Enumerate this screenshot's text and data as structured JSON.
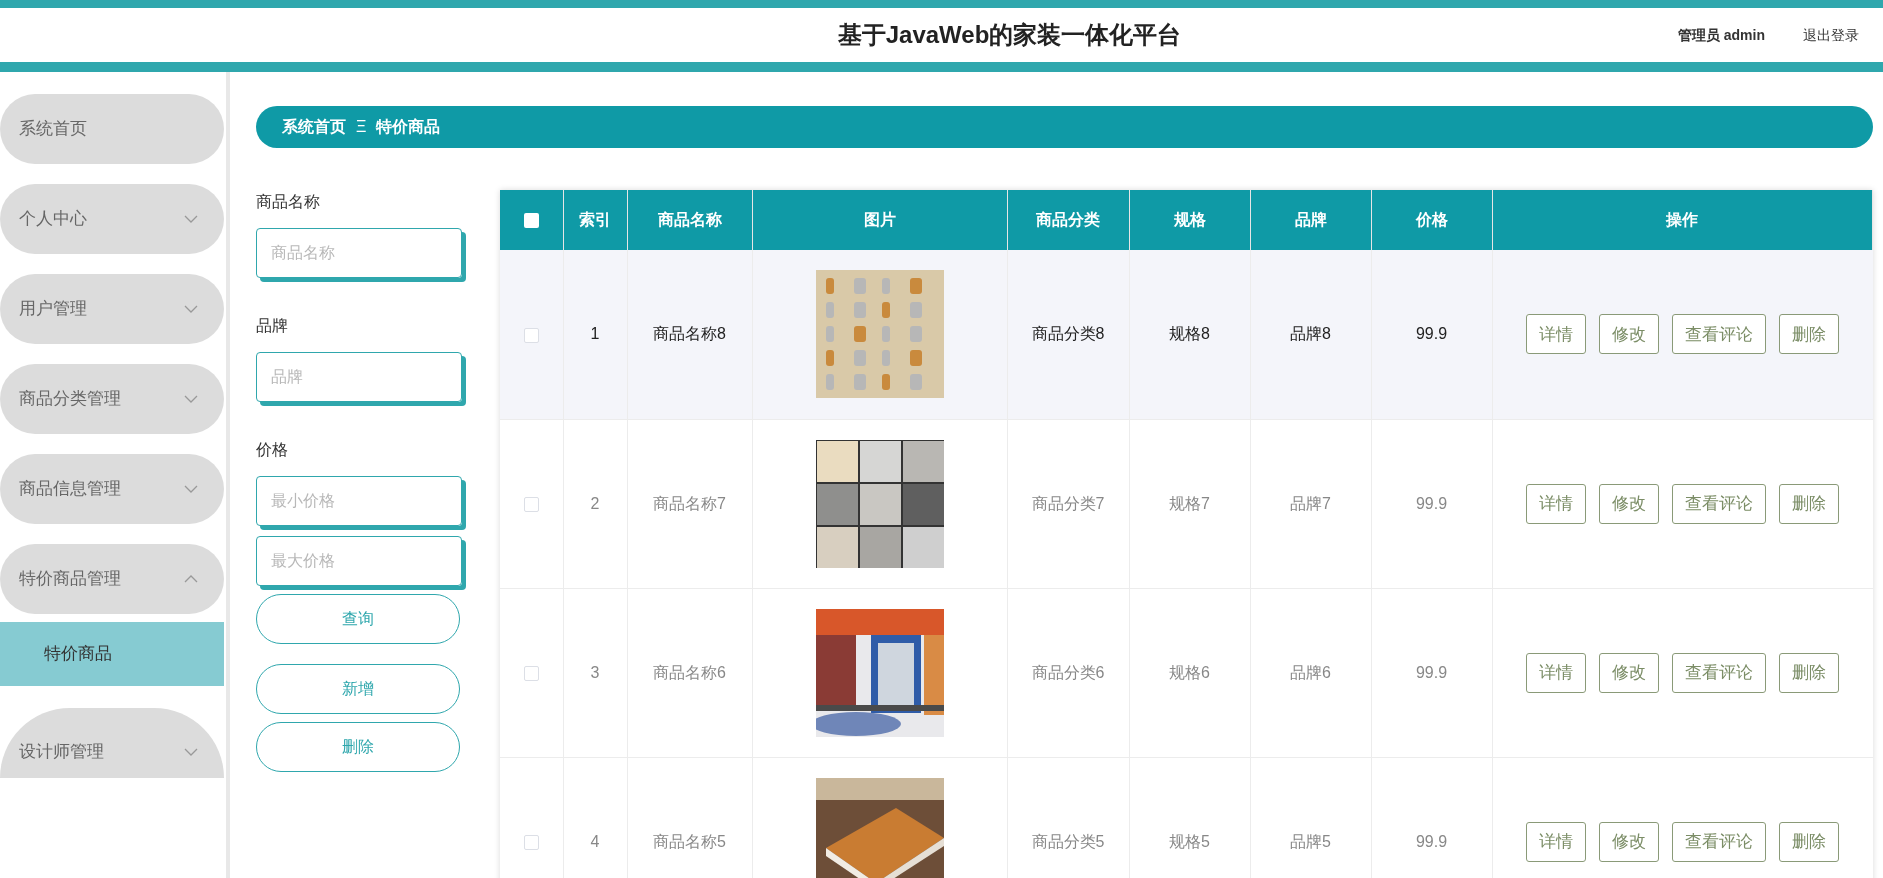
{
  "header": {
    "title": "基于JavaWeb的家装一体化平台",
    "user": "管理员 admin",
    "logout": "退出登录"
  },
  "sidebar": {
    "items": [
      {
        "label": "系统首页"
      },
      {
        "label": "个人中心",
        "expanded": false
      },
      {
        "label": "用户管理",
        "expanded": false
      },
      {
        "label": "商品分类管理",
        "expanded": false
      },
      {
        "label": "商品信息管理",
        "expanded": false
      },
      {
        "label": "特价商品管理",
        "expanded": true,
        "children": [
          {
            "label": "特价商品",
            "selected": true
          }
        ]
      },
      {
        "label": "设计师管理",
        "expanded": false
      }
    ]
  },
  "breadcrumb": {
    "items": [
      "系统首页",
      "特价商品"
    ],
    "separator": "Ξ"
  },
  "filters": {
    "fields": [
      {
        "label": "商品名称",
        "inputs": [
          {
            "placeholder": "商品名称"
          }
        ]
      },
      {
        "label": "品牌",
        "inputs": [
          {
            "placeholder": "品牌"
          }
        ]
      },
      {
        "label": "价格",
        "inputs": [
          {
            "placeholder": "最小价格"
          },
          {
            "placeholder": "最大价格"
          }
        ]
      }
    ],
    "buttons": [
      "查询",
      "新增",
      "删除"
    ]
  },
  "table": {
    "columns": [
      "索引",
      "商品名称",
      "图片",
      "商品分类",
      "规格",
      "品牌",
      "价格",
      "操作"
    ],
    "header_checked": false,
    "rows": [
      {
        "checked": false,
        "highlighted": true,
        "index": "1",
        "name": "商品名称8",
        "category": "商品分类8",
        "spec": "规格8",
        "brand": "品牌8",
        "price": "99.9",
        "actions": [
          "详情",
          "修改",
          "查看评论",
          "删除"
        ]
      },
      {
        "checked": false,
        "highlighted": false,
        "index": "2",
        "name": "商品名称7",
        "category": "商品分类7",
        "spec": "规格7",
        "brand": "品牌7",
        "price": "99.9",
        "actions": [
          "详情",
          "修改",
          "查看评论",
          "删除"
        ]
      },
      {
        "checked": false,
        "highlighted": false,
        "index": "3",
        "name": "商品名称6",
        "category": "商品分类6",
        "spec": "规格6",
        "brand": "品牌6",
        "price": "99.9",
        "actions": [
          "详情",
          "修改",
          "查看评论",
          "删除"
        ]
      },
      {
        "checked": false,
        "highlighted": false,
        "index": "4",
        "name": "商品名称5",
        "category": "商品分类5",
        "spec": "规格5",
        "brand": "品牌5",
        "price": "99.9",
        "actions": [
          "详情",
          "修改",
          "查看评论",
          "删除"
        ]
      }
    ]
  }
}
